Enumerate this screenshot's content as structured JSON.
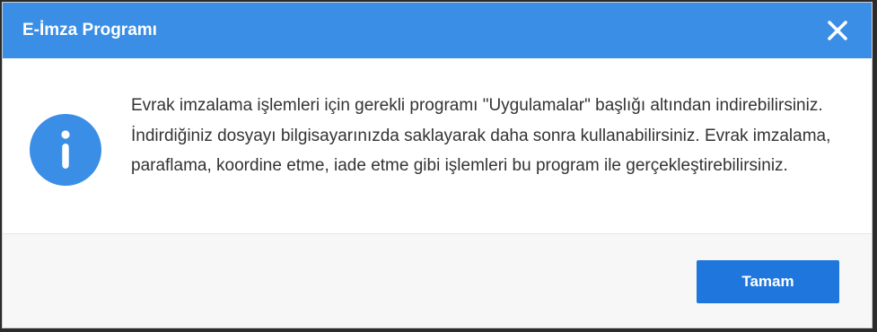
{
  "dialog": {
    "title": "E-İmza Programı",
    "close_icon": "close-icon",
    "info_icon": "info-icon",
    "message": "Evrak imzalama işlemleri için gerekli programı \"Uygulamalar\" başlığı altından indirebilirsiniz. İndirdiğiniz dosyayı bilgisayarınızda saklayarak daha sonra kullanabilirsiniz. Evrak imzalama, paraflama, koordine etme, iade etme gibi işlemleri bu program ile gerçekleştirebilirsiniz.",
    "ok_label": "Tamam"
  },
  "colors": {
    "titlebar": "#3a8ee6",
    "info_icon": "#3a8ee6",
    "ok_button": "#1f76dc",
    "footer": "#f7f7f7"
  }
}
